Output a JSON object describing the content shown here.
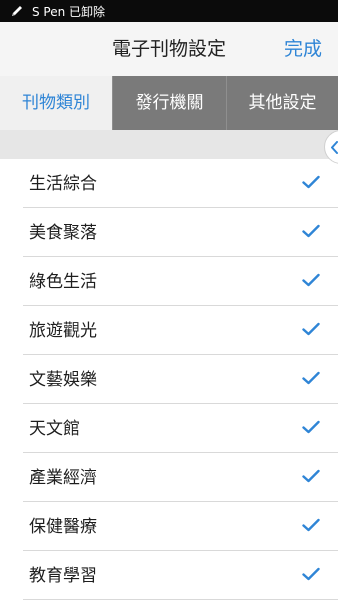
{
  "statusbar": {
    "icon": "pen-icon",
    "text": "S Pen 已卸除"
  },
  "header": {
    "title": "電子刊物設定",
    "done_label": "完成"
  },
  "tabs": [
    {
      "label": "刊物類別",
      "active": true
    },
    {
      "label": "發行機關",
      "active": false
    },
    {
      "label": "其他設定",
      "active": false
    }
  ],
  "side_handle": {
    "icon": "chevron-left-icon"
  },
  "categories": [
    {
      "label": "生活綜合",
      "checked": true
    },
    {
      "label": "美食聚落",
      "checked": true
    },
    {
      "label": "綠色生活",
      "checked": true
    },
    {
      "label": "旅遊觀光",
      "checked": true
    },
    {
      "label": "文藝娛樂",
      "checked": true
    },
    {
      "label": "天文館",
      "checked": true
    },
    {
      "label": "產業經濟",
      "checked": true
    },
    {
      "label": "保健醫療",
      "checked": true
    },
    {
      "label": "教育學習",
      "checked": true
    }
  ],
  "colors": {
    "accent": "#2f85d6",
    "tab_inactive": "#7a7a7a",
    "status_bar": "#0b0b0b"
  }
}
